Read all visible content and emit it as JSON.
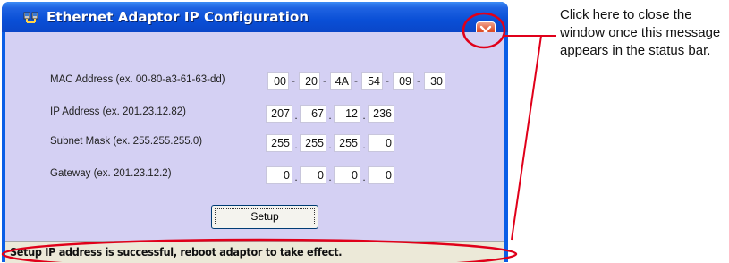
{
  "window": {
    "title": "Ethernet Adaptor IP Configuration",
    "close_icon": "close-x-icon",
    "app_icon": "network-adapter-icon"
  },
  "form": {
    "mac": {
      "label": "MAC Address (ex. 00-80-a3-61-63-dd)",
      "values": [
        "00",
        "20",
        "4A",
        "54",
        "09",
        "30"
      ],
      "separator": "-"
    },
    "ip": {
      "label": "IP Address (ex. 201.23.12.82)",
      "values": [
        "207",
        "67",
        "12",
        "236"
      ],
      "separator": "."
    },
    "subnet": {
      "label": "Subnet Mask (ex. 255.255.255.0)",
      "values": [
        "255",
        "255",
        "255",
        "0"
      ],
      "separator": "."
    },
    "gateway": {
      "label": "Gateway (ex. 201.23.12.2)",
      "values": [
        "0",
        "0",
        "0",
        "0"
      ],
      "separator": "."
    }
  },
  "setup_button": {
    "label": "Setup"
  },
  "status_bar": {
    "text": "Setup IP address is successful, reboot adaptor to take effect."
  },
  "annotation": {
    "text": "Click here to close the window once this message appears in the status bar.",
    "color": "#e0001a"
  }
}
